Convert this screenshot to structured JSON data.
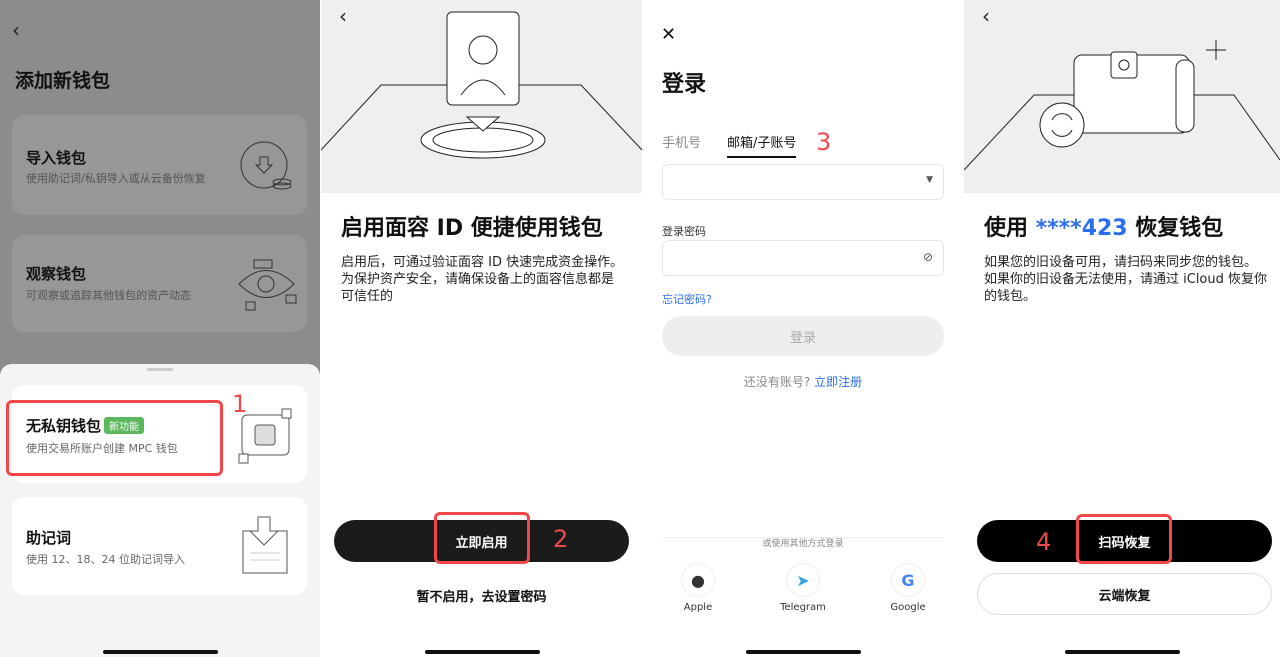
{
  "panel1": {
    "title": "添加新钱包",
    "items": [
      {
        "title": "导入钱包",
        "desc": "使用助记词/私钥导入或从云备份恢复",
        "icon": "download-coins-icon"
      },
      {
        "title": "观察钱包",
        "desc": "可观察或追踪其他钱包的资产动态",
        "icon": "eye-icon"
      },
      {
        "title": "无私钥钱包",
        "badge": "新功能",
        "desc": "使用交易所账户创建 MPC 钱包",
        "icon": "mpc-chip-icon"
      },
      {
        "title": "助记词",
        "desc": "使用 12、18、24 位助记词导入",
        "icon": "import-doc-icon"
      }
    ],
    "annotation": "1"
  },
  "panel2": {
    "title": "启用面容 ID 便捷使用钱包",
    "desc": "启用后，可通过验证面容 ID 快速完成资金操作。为保护资产安全，请确保设备上的面容信息都是可信任的",
    "primary": "立即启用",
    "secondary": "暂不启用，去设置密码",
    "annotation": "2"
  },
  "panel3": {
    "title": "登录",
    "tabs": [
      "手机号",
      "邮箱/子账号"
    ],
    "active_tab": 1,
    "annotation": "3",
    "account_value": "",
    "password_label": "登录密码",
    "password_value": "",
    "forgot": "忘记密码?",
    "login": "登录",
    "no_account": "还没有账号?",
    "register": "立即注册",
    "other": "或使用其他方式登录",
    "social": [
      "Apple",
      "Telegram",
      "Google"
    ]
  },
  "panel4": {
    "title_pre": "使用 ",
    "title_acct": "****423",
    "title_post": " 恢复钱包",
    "desc": "如果您的旧设备可用，请扫码来同步您的钱包。如果你的旧设备无法使用，请通过 iCloud 恢复你的钱包。",
    "primary": "扫码恢复",
    "secondary": "云端恢复",
    "annotation": "4",
    "accent": "#2a6ef0"
  }
}
